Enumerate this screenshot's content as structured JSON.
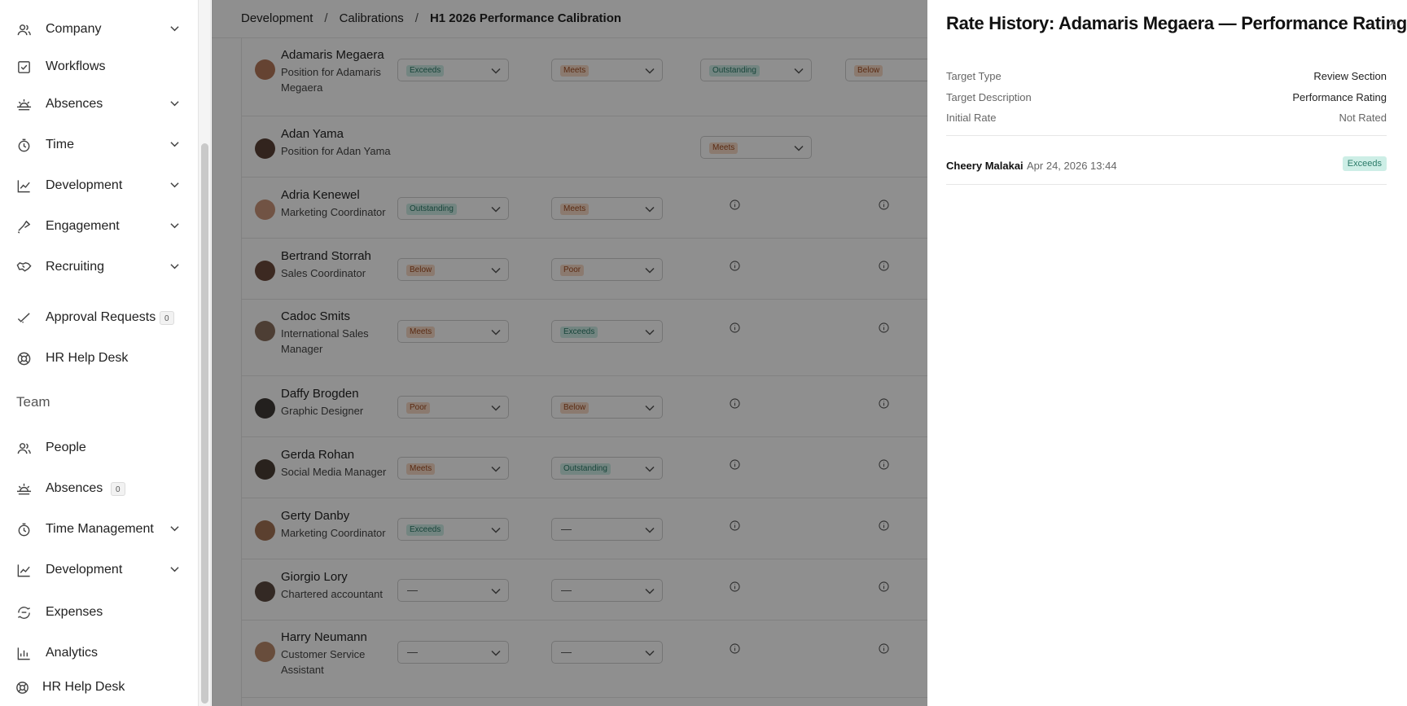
{
  "sidebar": {
    "items": [
      {
        "label": "Company",
        "icon": "users-icon"
      },
      {
        "label": "Workflows",
        "icon": "checkbox-icon"
      },
      {
        "label": "Absences",
        "icon": "sunrise-icon"
      },
      {
        "label": "Time",
        "icon": "stopwatch-icon"
      },
      {
        "label": "Development",
        "icon": "chart-line-icon"
      },
      {
        "label": "Engagement",
        "icon": "megaphone-icon"
      },
      {
        "label": "Recruiting",
        "icon": "handshake-icon"
      },
      {
        "label": "Approval Requests",
        "icon": "check-icon",
        "count": "0"
      },
      {
        "label": "HR Help Desk",
        "icon": "lifebuoy-icon"
      }
    ],
    "team_heading": "Team",
    "team_items": [
      {
        "label": "People",
        "icon": "users-icon"
      },
      {
        "label": "Absences",
        "icon": "sunrise-icon",
        "count": "0"
      },
      {
        "label": "Time Management",
        "icon": "stopwatch-icon"
      },
      {
        "label": "Development",
        "icon": "chart-line-icon"
      },
      {
        "label": "Expenses",
        "icon": "wallet-icon"
      },
      {
        "label": "Analytics",
        "icon": "bar-chart-icon"
      },
      {
        "label": "HR Help Desk",
        "icon": "lifebuoy-icon"
      }
    ]
  },
  "breadcrumb": {
    "items": [
      "Development",
      "Calibrations",
      "H1 2026 Performance Calibration"
    ],
    "separator": "/"
  },
  "table": {
    "rows": [
      {
        "name": "Adamaris Megaera",
        "position": "Position for Adamaris Megaera",
        "ratings": [
          "Exceeds",
          "Meets",
          "Outstanding",
          "Below"
        ]
      },
      {
        "name": "Adan Yama",
        "position": "Position for Adan Yama",
        "ratings": [
          null,
          null,
          "Meets"
        ]
      },
      {
        "name": "Adria Kenewel",
        "position": "Marketing Coordinator",
        "ratings": [
          "Outstanding",
          "Meets"
        ]
      },
      {
        "name": "Bertrand Storrah",
        "position": "Sales Coordinator",
        "ratings": [
          "Below",
          "Poor"
        ]
      },
      {
        "name": "Cadoc Smits",
        "position": "International Sales Manager",
        "ratings": [
          "Meets",
          "Exceeds"
        ]
      },
      {
        "name": "Daffy Brogden",
        "position": "Graphic Designer",
        "ratings": [
          "Poor",
          "Below"
        ]
      },
      {
        "name": "Gerda Rohan",
        "position": "Social Media Manager",
        "ratings": [
          "Meets",
          "Outstanding"
        ]
      },
      {
        "name": "Gerty Danby",
        "position": "Marketing Coordinator",
        "ratings": [
          "Exceeds",
          "—"
        ]
      },
      {
        "name": "Giorgio Lory",
        "position": "Chartered accountant",
        "ratings": [
          "—",
          "—"
        ]
      },
      {
        "name": "Harry Neumann",
        "position": "Customer Service Assistant",
        "ratings": [
          "—",
          "—"
        ]
      }
    ]
  },
  "rating_colors": {
    "positive_bg": "#cdeee6",
    "positive_text": "#2b7a68",
    "negative_bg": "#f8d9c7",
    "negative_text": "#a04e22"
  },
  "drawer": {
    "title": "Rate History: Adamaris Megaera — Performance Rating",
    "close": "×",
    "fields": [
      {
        "label": "Target Type",
        "value": "Review Section"
      },
      {
        "label": "Target Description",
        "value": "Performance Rating"
      },
      {
        "label": "Initial Rate",
        "value": "Not Rated"
      }
    ],
    "history": [
      {
        "user": "Cheery Malakai",
        "time": "Apr 24, 2026 13:44",
        "rating": "Exceeds"
      }
    ]
  }
}
